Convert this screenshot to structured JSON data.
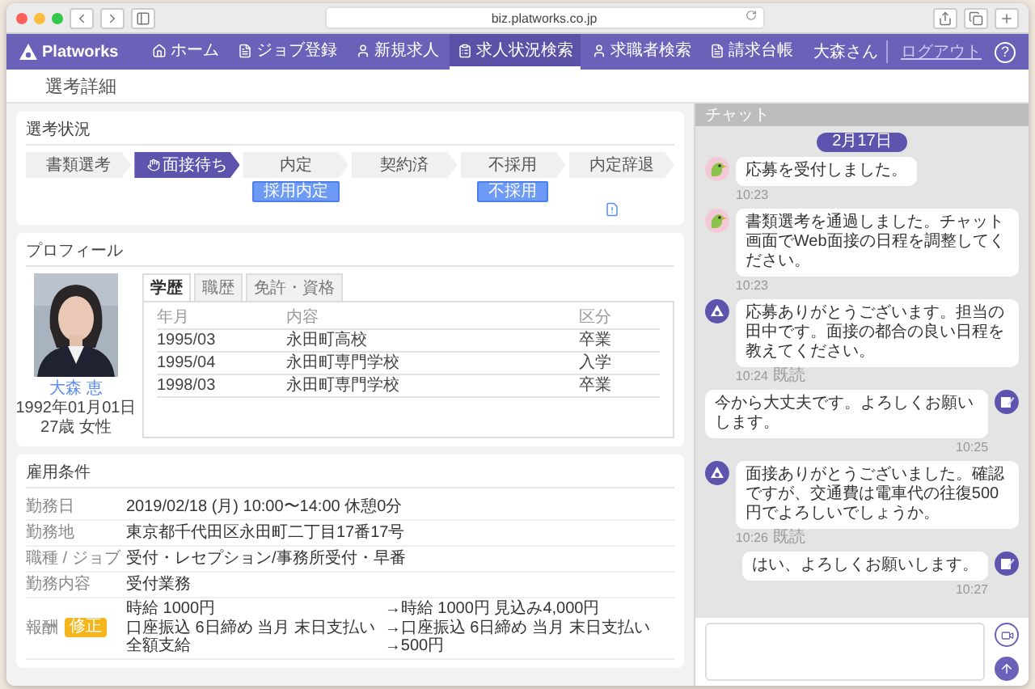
{
  "browser": {
    "url": "biz.platworks.co.jp"
  },
  "nav": {
    "brand": "Platworks",
    "items": [
      {
        "label": "ホーム",
        "selected": false
      },
      {
        "label": "ジョブ登録",
        "selected": false
      },
      {
        "label": "新規求人",
        "selected": false
      },
      {
        "label": "求人状況検索",
        "selected": true
      },
      {
        "label": "求職者検索",
        "selected": false
      },
      {
        "label": "請求台帳",
        "selected": false
      }
    ],
    "user": "大森さん",
    "logout": "ログアウト",
    "help": "?"
  },
  "page_title": "選考詳細",
  "selection": {
    "title": "選考状況",
    "steps": [
      {
        "label": "書類選考",
        "selected": false
      },
      {
        "label": "面接待ち",
        "selected": true
      },
      {
        "label": "内定",
        "selected": false,
        "action": "採用内定"
      },
      {
        "label": "契約済",
        "selected": false
      },
      {
        "label": "不採用",
        "selected": false,
        "action": "不採用"
      },
      {
        "label": "内定辞退",
        "selected": false
      }
    ]
  },
  "profile": {
    "title": "プロフィール",
    "name": "大森 恵",
    "birthday": "1992年01月01日",
    "age_gender": "27歳 女性",
    "tabs": [
      {
        "label": "学歴",
        "selected": true
      },
      {
        "label": "職歴",
        "selected": false
      },
      {
        "label": "免許・資格",
        "selected": false
      }
    ],
    "columns": [
      "年月",
      "内容",
      "区分"
    ],
    "rows": [
      [
        "1995/03",
        "永田町高校",
        "卒業"
      ],
      [
        "1995/04",
        "永田町専門学校",
        "入学"
      ],
      [
        "1998/03",
        "永田町専門学校",
        "卒業"
      ]
    ]
  },
  "employment": {
    "title": "雇用条件",
    "rows": [
      {
        "kind": "text",
        "label": "勤務日",
        "value": "2019/02/18 (月) 10:00〜14:00 休憩0分"
      },
      {
        "kind": "text",
        "label": "勤務地",
        "value": "東京都千代田区永田町二丁目17番17号"
      },
      {
        "kind": "text",
        "label": "職種 / ジョブ",
        "value": "受付・レセプション/事務所受付・早番"
      },
      {
        "kind": "text",
        "label": "勤務内容",
        "value": "受付業務"
      },
      {
        "kind": "change",
        "label": "報酬",
        "badge": "修正",
        "before": [
          "時給 1000円",
          "口座振込 6日締め 当月 末日支払い",
          "全額支給"
        ],
        "after": [
          "→時給 1000円 見込み4,000円",
          "→口座振込 6日締め 当月 末日支払い",
          "→500円"
        ]
      }
    ]
  },
  "chat": {
    "title": "チャット",
    "date": "2月17日",
    "messages": [
      {
        "kind": "bot",
        "text": "応募を受付しました。",
        "time": "10:23"
      },
      {
        "kind": "bot",
        "text": "書類選考を通過しました。チャット画面でWeb面接の日程を調整してください。",
        "time": "10:23"
      },
      {
        "kind": "company",
        "text": "応募ありがとうございます。担当の田中です。面接の都合の良い日程を教えてください。",
        "time": "10:24",
        "status": "既読"
      },
      {
        "kind": "user",
        "text": "今から大丈夫です。よろしくお願いします。",
        "time": "10:25"
      },
      {
        "kind": "company",
        "text": "面接ありがとうございました。確認ですが、交通費は電車代の往復500円でよろしいでしょうか。",
        "time": "10:26",
        "status": "既読"
      },
      {
        "kind": "user",
        "text": "はい、よろしくお願いします。",
        "time": "10:27"
      }
    ]
  }
}
